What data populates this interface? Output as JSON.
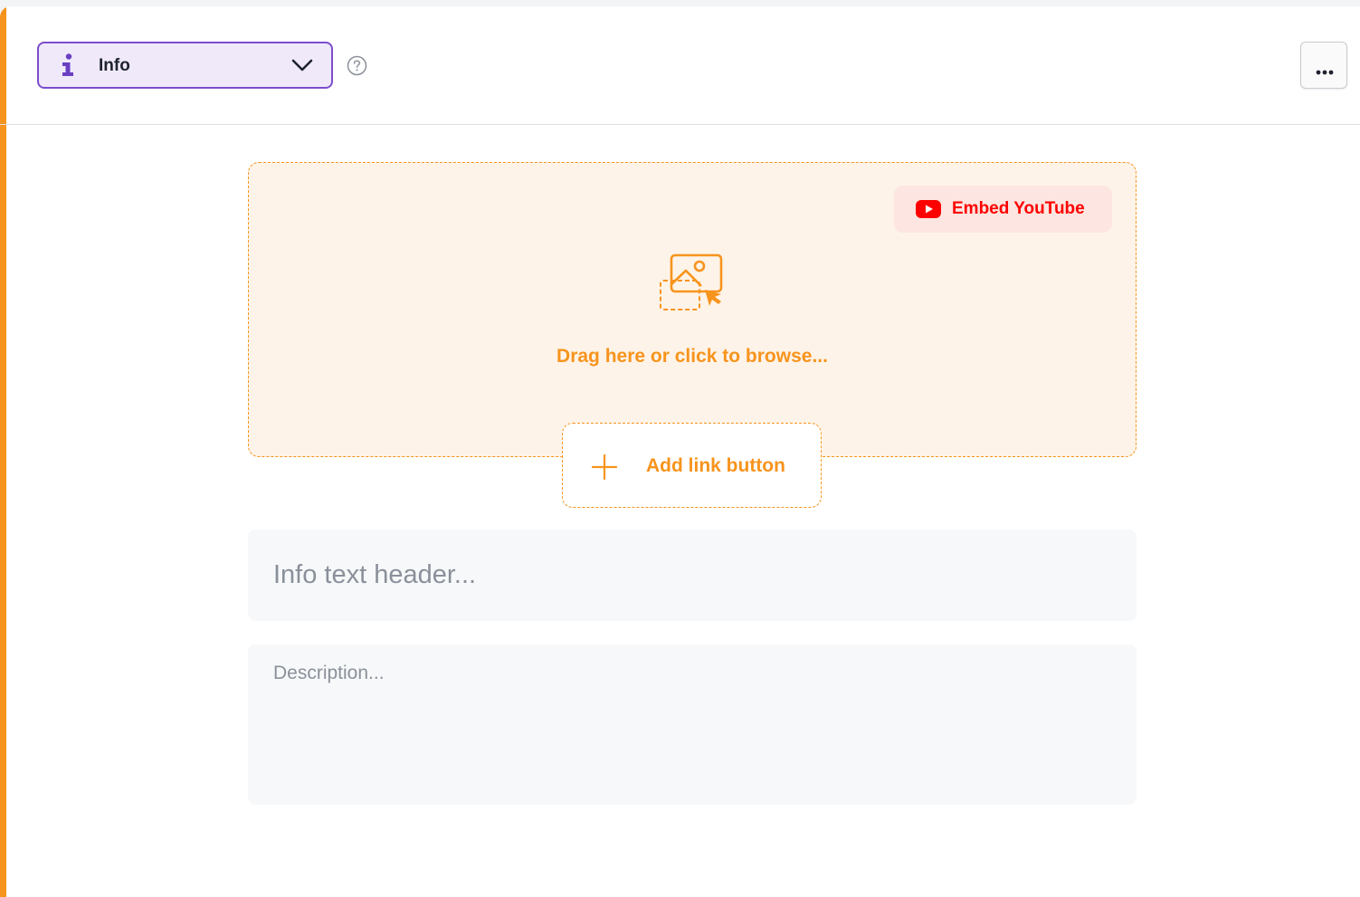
{
  "block": {
    "type_select": {
      "icon": "info-icon",
      "label": "Info",
      "chevron_icon": "chevron-down-icon"
    },
    "help_icon": "help-circle-icon",
    "more_menu_icon": "more-horizontal-icon"
  },
  "media": {
    "embed_youtube_label": "Embed YouTube",
    "upload_icon": "image-drop-icon",
    "drop_prompt": "Drag here or click to browse..."
  },
  "link_button": {
    "label": "Add link button",
    "icon": "plus-icon"
  },
  "header_field": {
    "placeholder": "Info text header...",
    "value": ""
  },
  "description_field": {
    "placeholder": "Description...",
    "value": ""
  },
  "colors": {
    "accent": "#f7941d",
    "type_select_border": "#7c4dcc",
    "type_select_bg": "#efe9fa",
    "youtube_red": "#ff0000",
    "dropzone_bg": "#fef3e8"
  }
}
